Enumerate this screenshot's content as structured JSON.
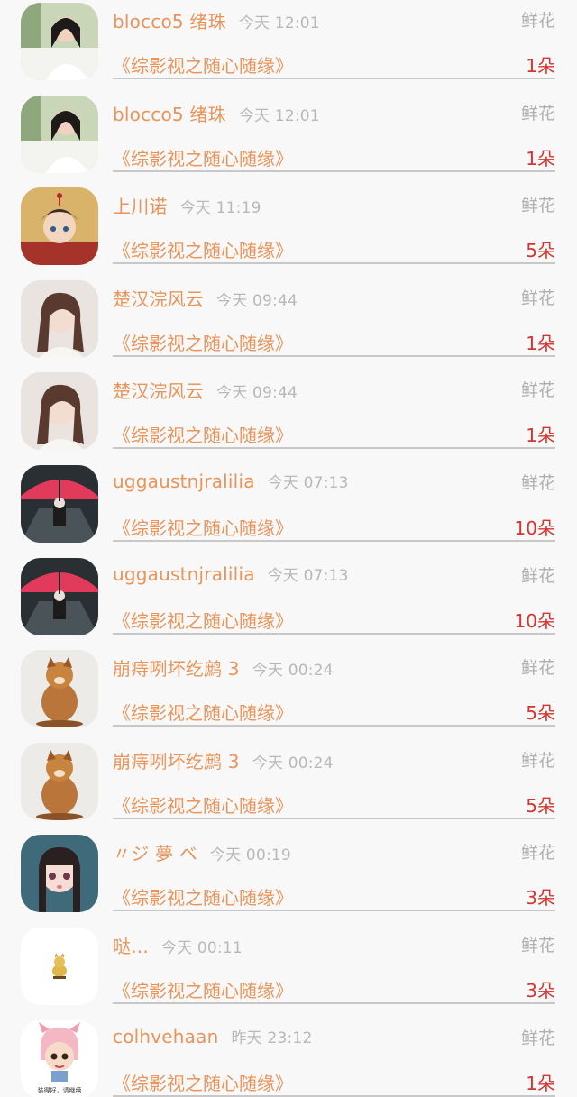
{
  "gift_label": "鲜花",
  "rows": [
    {
      "name": "blocco5 绪珠",
      "time": "今天 12:01",
      "novel": "《综影视之随心随缘》",
      "count": "1朵",
      "avatar": "girl-photo-icon"
    },
    {
      "name": "blocco5 绪珠",
      "time": "今天 12:01",
      "novel": "《综影视之随心随缘》",
      "count": "1朵",
      "avatar": "girl-photo-icon"
    },
    {
      "name": "上川诺",
      "time": "今天 11:19",
      "novel": "《综影视之随心随缘》",
      "count": "5朵",
      "avatar": "anime-character-icon"
    },
    {
      "name": "楚汉浣风云",
      "time": "今天 09:44",
      "novel": "《综影视之随心随缘》",
      "count": "1朵",
      "avatar": "woman-portrait-icon"
    },
    {
      "name": "楚汉浣风云",
      "time": "今天 09:44",
      "novel": "《综影视之随心随缘》",
      "count": "1朵",
      "avatar": "woman-portrait-icon"
    },
    {
      "name": "uggaustnjralilia",
      "time": "今天 07:13",
      "novel": "《综影视之随心随缘》",
      "count": "10朵",
      "avatar": "red-umbrella-icon"
    },
    {
      "name": "uggaustnjralilia",
      "time": "今天 07:13",
      "novel": "《综影视之随心随缘》",
      "count": "10朵",
      "avatar": "red-umbrella-icon"
    },
    {
      "name": "崩痔咧坏纥鹧 3",
      "time": "今天 00:24",
      "novel": "《综影视之随心随缘》",
      "count": "5朵",
      "avatar": "dog-figure-icon"
    },
    {
      "name": "崩痔咧坏纥鹧 3",
      "time": "今天 00:24",
      "novel": "《综影视之随心随缘》",
      "count": "5朵",
      "avatar": "dog-figure-icon"
    },
    {
      "name": "〃ジ 夢 ベ",
      "time": "今天 00:19",
      "novel": "《综影视之随心随缘》",
      "count": "3朵",
      "avatar": "doll-girl-icon"
    },
    {
      "name": "哒...",
      "time": "今天 00:11",
      "novel": "《综影视之随心随缘》",
      "count": "3朵",
      "avatar": "cartoon-cat-icon"
    },
    {
      "name": "colhvehaan",
      "time": "昨天 23:12",
      "novel": "《综影视之随心随缘》",
      "count": "1朵",
      "avatar": "pig-hat-girl-icon",
      "avatar_caption": "装得好，请继续"
    }
  ]
}
